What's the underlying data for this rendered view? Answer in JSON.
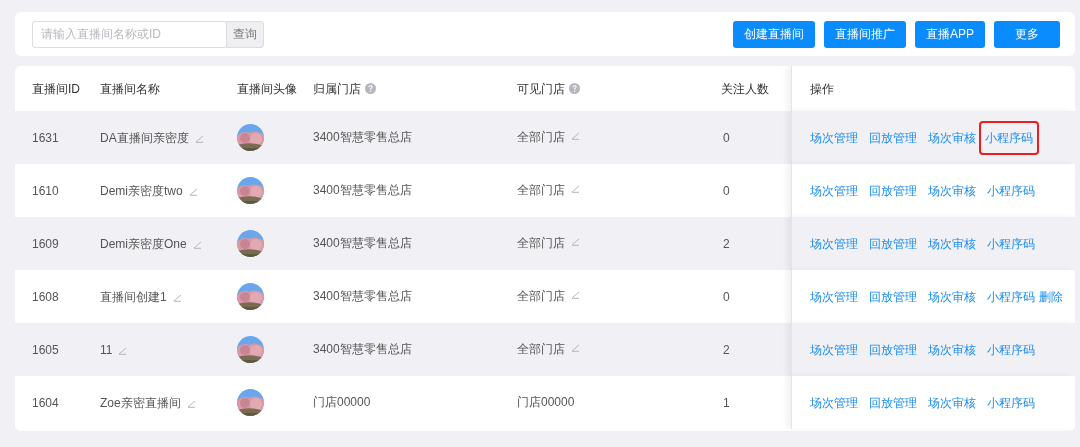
{
  "search": {
    "placeholder": "请输入直播间名称或ID",
    "button": "查询"
  },
  "toolbar_buttons": [
    "创建直播间",
    "直播间推广",
    "直播APP",
    "更多"
  ],
  "table": {
    "columns": [
      {
        "label": "直播间ID",
        "help": false
      },
      {
        "label": "直播间名称",
        "help": false
      },
      {
        "label": "直播间头像",
        "help": false
      },
      {
        "label": "归属门店",
        "help": true
      },
      {
        "label": "可见门店",
        "help": true
      },
      {
        "label": "关注人数",
        "help": false
      },
      {
        "label": "操作",
        "help": false
      }
    ],
    "rows": [
      {
        "id": "1631",
        "name": "DA直播间亲密度",
        "avatar": {
          "kind": "picture"
        },
        "store": "3400智慧零售总店",
        "visible_store": "全部门店",
        "visible_editable": true,
        "followers": "0",
        "actions": [
          {
            "label": "场次管理",
            "highlighted": false
          },
          {
            "label": "回放管理",
            "highlighted": false
          },
          {
            "label": "场次审核",
            "highlighted": false
          },
          {
            "label": "小程序码",
            "highlighted": true
          }
        ]
      },
      {
        "id": "1610",
        "name": "Demi亲密度two",
        "avatar": {
          "kind": "picture"
        },
        "store": "3400智慧零售总店",
        "visible_store": "全部门店",
        "visible_editable": true,
        "followers": "0",
        "actions": [
          {
            "label": "场次管理",
            "highlighted": false
          },
          {
            "label": "回放管理",
            "highlighted": false
          },
          {
            "label": "场次审核",
            "highlighted": false
          },
          {
            "label": "小程序码",
            "highlighted": false
          }
        ]
      },
      {
        "id": "1609",
        "name": "Demi亲密度One",
        "avatar": {
          "kind": "picture"
        },
        "store": "3400智慧零售总店",
        "visible_store": "全部门店",
        "visible_editable": true,
        "followers": "2",
        "actions": [
          {
            "label": "场次管理",
            "highlighted": false
          },
          {
            "label": "回放管理",
            "highlighted": false
          },
          {
            "label": "场次审核",
            "highlighted": false
          },
          {
            "label": "小程序码",
            "highlighted": false
          }
        ]
      },
      {
        "id": "1608",
        "name": "直播间创建1",
        "avatar": {
          "kind": "picture"
        },
        "store": "3400智慧零售总店",
        "visible_store": "全部门店",
        "visible_editable": true,
        "followers": "0",
        "actions": [
          {
            "label": "场次管理",
            "highlighted": false
          },
          {
            "label": "回放管理",
            "highlighted": false
          },
          {
            "label": "场次审核",
            "highlighted": false
          },
          {
            "label": "小程序码",
            "highlighted": false
          },
          {
            "label": "删除",
            "highlighted": false
          }
        ]
      },
      {
        "id": "1605",
        "name": "11",
        "avatar": {
          "kind": "picture"
        },
        "store": "3400智慧零售总店",
        "visible_store": "全部门店",
        "visible_editable": true,
        "followers": "2",
        "actions": [
          {
            "label": "场次管理",
            "highlighted": false
          },
          {
            "label": "回放管理",
            "highlighted": false
          },
          {
            "label": "场次审核",
            "highlighted": false
          },
          {
            "label": "小程序码",
            "highlighted": false
          }
        ]
      },
      {
        "id": "1604",
        "name": "Zoe亲密直播间",
        "avatar": {
          "kind": "picture"
        },
        "store": "门店00000",
        "visible_store": "门店00000",
        "visible_editable": false,
        "followers": "1",
        "actions": [
          {
            "label": "场次管理",
            "highlighted": false
          },
          {
            "label": "回放管理",
            "highlighted": false
          },
          {
            "label": "场次审核",
            "highlighted": false
          },
          {
            "label": "小程序码",
            "highlighted": false
          }
        ]
      }
    ]
  }
}
